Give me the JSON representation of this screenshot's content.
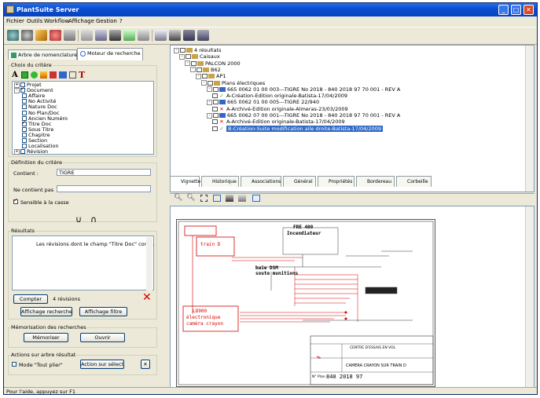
{
  "window": {
    "title": "PlantSuite Server"
  },
  "menu": [
    "Fichier",
    "Outils",
    "Workflow",
    "Affichage",
    "Gestion",
    "?"
  ],
  "left_tabs": [
    "Arbre de nomenclature",
    "Moteur de recherche"
  ],
  "criteria": {
    "group_label": "Choix du critère",
    "items": [
      {
        "label": "Projet",
        "checked": false,
        "expander": "+"
      },
      {
        "label": "Document",
        "checked": true,
        "expander": "-"
      },
      {
        "label": "Affaire",
        "checked": false
      },
      {
        "label": "No Activité",
        "checked": false
      },
      {
        "label": "Nature Doc",
        "checked": false
      },
      {
        "label": "No Plan/Doc",
        "checked": false
      },
      {
        "label": "Ancien Numéro",
        "checked": false
      },
      {
        "label": "Titre Doc",
        "checked": true
      },
      {
        "label": "Sous Titre",
        "checked": false
      },
      {
        "label": "Chapitre",
        "checked": false
      },
      {
        "label": "Section",
        "checked": false
      },
      {
        "label": "Localisation",
        "checked": false
      },
      {
        "label": "Révision",
        "checked": false,
        "expander": "+"
      }
    ]
  },
  "definition": {
    "group_label": "Définition du critère",
    "contient_label": "Contient :",
    "contient_value": "TIGRE",
    "ne_contient_label": "Ne contient pas",
    "ne_contient_value": "",
    "case_label": "Sensible à la casse",
    "case_checked": true
  },
  "set_ops": [
    "∪",
    "∩"
  ],
  "results": {
    "group_label": "Résultats",
    "text": "Les révisions dont le champ \"Titre Doc\" cont...",
    "count_button": "Compter",
    "count_text": "4 révisions",
    "show_search": "Affichage recherche",
    "show_filter": "Affichage filtre"
  },
  "memo": {
    "group_label": "Mémorisation des recherches",
    "save": "Mémoriser",
    "open": "Ouvrir"
  },
  "actions": {
    "group_label": "Actions sur arbre résultat",
    "mode_label": "Mode \"Tout plier\"",
    "selection_button": "Action sur sélection"
  },
  "tree": [
    {
      "level": 0,
      "text": "4 résultats"
    },
    {
      "level": 1,
      "text": "Caisaux"
    },
    {
      "level": 2,
      "text": "PALCON 2000"
    },
    {
      "level": 3,
      "text": "B62"
    },
    {
      "level": 4,
      "text": "AP1"
    },
    {
      "level": 5,
      "text": "Plans électriques"
    },
    {
      "level": 6,
      "text": "665 0062 01 00 003---TIGRE No 2018 - 840 2018 97 70 001 - REV A"
    },
    {
      "level": 7,
      "text": "A-Création-Edition originale-Batista-17/04/2009",
      "mark": "check"
    },
    {
      "level": 6,
      "text": "665 0062 01 00 005---TIGRE 22/940"
    },
    {
      "level": 7,
      "text": "A-Archivé-Edition originale-Almeras-23/03/2009",
      "mark": "x"
    },
    {
      "level": 6,
      "text": "665 0062 07 00 001---TIGRE No 2018 - 840 2018 97 70 001 - REV A"
    },
    {
      "level": 7,
      "text": "A-Archivé-Edition originale-Batista-17/04/2009",
      "mark": "x"
    },
    {
      "level": 7,
      "text": "B-Création-Suite modification aile droite-Batista-17/04/2009",
      "mark": "check",
      "selected": true
    }
  ],
  "viewer_tabs": [
    "Vignette",
    "Historique",
    "Associations",
    "Général",
    "Propriétés",
    "Bordereau",
    "Corbeille"
  ],
  "drawing": {
    "title_top": "FRE 400",
    "subtitle_top": "Incendiateur",
    "label_train": "train D",
    "label_baie": "baie DSM",
    "label_baie2": "soute munitions",
    "label_ld900": "LD900",
    "label_electronique": "électronique",
    "label_camera": "caméra crayon",
    "title_block_1": "CENTRE D'ESSAIS EN VOL",
    "title_block_2": "CAMERA CRAYON SUR TRAIN D",
    "plan_no_label": "N° Plan :",
    "plan_no": "840 2018 97"
  },
  "status": "Pour l'aide, appuyez sur F1",
  "colors": {
    "title": "#0a4fd4",
    "accent": "#316ac5",
    "red": "#d40000"
  }
}
